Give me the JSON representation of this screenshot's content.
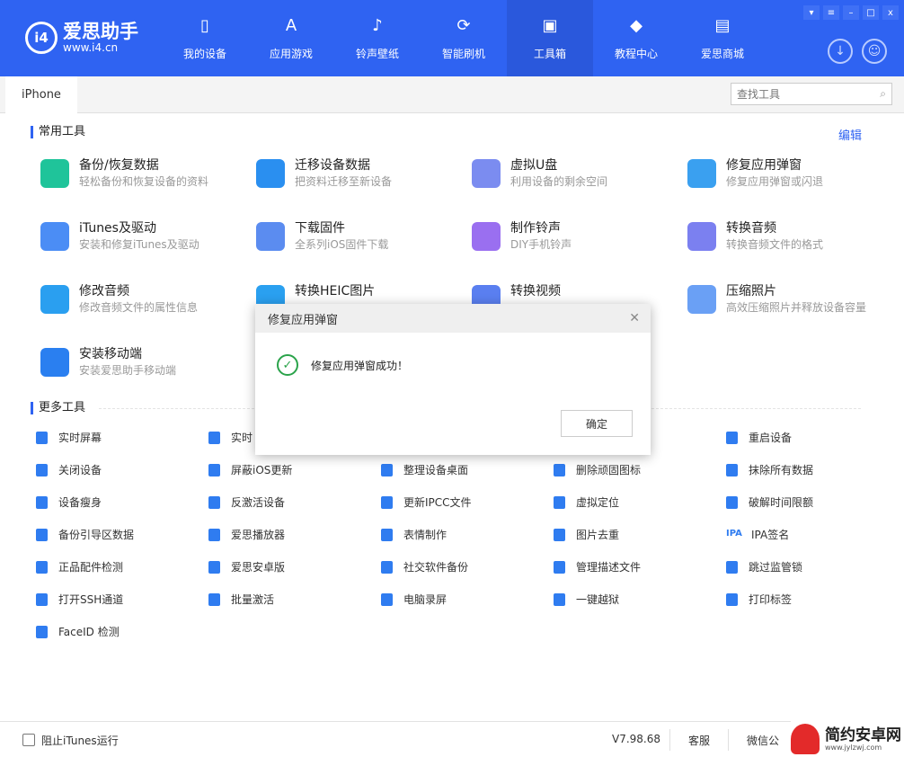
{
  "app": {
    "logo_name": "爱思助手",
    "logo_url": "www.i4.cn",
    "logo_mark": "i4"
  },
  "nav": [
    {
      "label": "我的设备",
      "icon": "phone-icon",
      "glyph": "▯"
    },
    {
      "label": "应用游戏",
      "icon": "app-store-icon",
      "glyph": "A"
    },
    {
      "label": "铃声壁纸",
      "icon": "music-icon",
      "glyph": "♪"
    },
    {
      "label": "智能刷机",
      "icon": "refresh-icon",
      "glyph": "⟳"
    },
    {
      "label": "工具箱",
      "icon": "toolbox-icon",
      "glyph": "▣",
      "active": true
    },
    {
      "label": "教程中心",
      "icon": "graduation-cap-icon",
      "glyph": "◆"
    },
    {
      "label": "爱思商城",
      "icon": "store-icon",
      "glyph": "▤"
    }
  ],
  "window_buttons": [
    {
      "icon": "shirt-icon",
      "glyph": "▾"
    },
    {
      "icon": "menu-icon",
      "glyph": "≡"
    },
    {
      "icon": "minimize-icon",
      "glyph": "–"
    },
    {
      "icon": "maximize-icon",
      "glyph": "□"
    },
    {
      "icon": "close-icon",
      "glyph": "x"
    }
  ],
  "tab": "iPhone",
  "search": {
    "placeholder": "查找工具"
  },
  "common": {
    "title": "常用工具",
    "edit": "编辑",
    "items": [
      {
        "t": "备份/恢复数据",
        "d": "轻松备份和恢复设备的资料",
        "c": "#1fc49a"
      },
      {
        "t": "迁移设备数据",
        "d": "把资料迁移至新设备",
        "c": "#2a8ff0"
      },
      {
        "t": "虚拟U盘",
        "d": "利用设备的剩余空间",
        "c": "#7b8cf0"
      },
      {
        "t": "修复应用弹窗",
        "d": "修复应用弹窗或闪退",
        "c": "#3aa0f0"
      },
      {
        "t": "iTunes及驱动",
        "d": "安装和修复iTunes及驱动",
        "c": "#4b8df5"
      },
      {
        "t": "下载固件",
        "d": "全系列iOS固件下载",
        "c": "#5b8cf0"
      },
      {
        "t": "制作铃声",
        "d": "DIY手机铃声",
        "c": "#9a6ff0"
      },
      {
        "t": "转换音频",
        "d": "转换音频文件的格式",
        "c": "#7b80f0"
      },
      {
        "t": "修改音频",
        "d": "修改音频文件的属性信息",
        "c": "#2a9ff0"
      },
      {
        "t": "转换HEIC图片",
        "d": "",
        "c": "#2aa0f0"
      },
      {
        "t": "转换视频",
        "d": "",
        "c": "#5a7ff0"
      },
      {
        "t": "压缩照片",
        "d": "高效压缩照片并释放设备容量",
        "c": "#6aa0f5"
      },
      {
        "t": "安装移动端",
        "d": "安装爱思助手移动端",
        "c": "#2a7ff0"
      }
    ]
  },
  "more": {
    "title": "更多工具",
    "items": [
      "实时屏幕",
      "实时",
      "",
      "",
      "重启设备",
      "关闭设备",
      "屏蔽iOS更新",
      "整理设备桌面",
      "删除顽固图标",
      "抹除所有数据",
      "设备瘦身",
      "反激活设备",
      "更新IPCC文件",
      "虚拟定位",
      "破解时间限额",
      "备份引导区数据",
      "爱思播放器",
      "表情制作",
      "图片去重",
      "IPA签名",
      "正品配件检测",
      "爱思安卓版",
      "社交软件备份",
      "管理描述文件",
      "跳过监管锁",
      "打开SSH通道",
      "批量激活",
      "电脑录屏",
      "一键越狱",
      "打印标签",
      "FaceID 检测"
    ]
  },
  "dialog": {
    "title": "修复应用弹窗",
    "message": "修复应用弹窗成功！",
    "ok": "确定"
  },
  "footer": {
    "checkbox_label": "阻止iTunes运行",
    "version": "V7.98.68",
    "service": "客服",
    "wechat": "微信公"
  },
  "watermark": {
    "name": "简约安卓网",
    "url": "www.jylzwj.com"
  },
  "colors": {
    "brand": "#2f63f2",
    "success": "#2aa34a"
  }
}
